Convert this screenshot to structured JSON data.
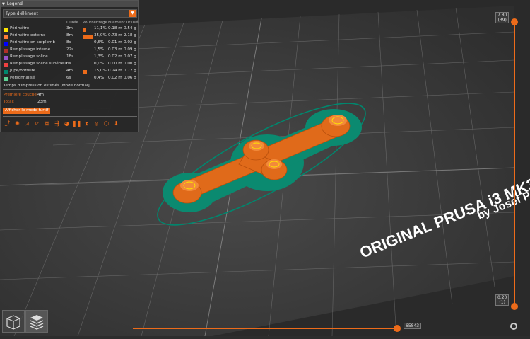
{
  "legend": {
    "title": "Legend",
    "view_type": "Type d'élément",
    "columns": {
      "duration": "Durée",
      "percentage": "Pourcentage",
      "filament": "Filament utilisé"
    },
    "rows": [
      {
        "name": "Périmètre",
        "color": "#ffe600",
        "duration": "3m",
        "pct": "11,1%",
        "len": "0.18 m",
        "weight": "0.54 g",
        "fraction": 0.111
      },
      {
        "name": "Périmètre externe",
        "color": "#ff7d38",
        "duration": "8m",
        "pct": "35,0%",
        "len": "0.73 m",
        "weight": "2.18 g",
        "fraction": 0.35
      },
      {
        "name": "Périmètre en surplomb",
        "color": "#0000ff",
        "duration": "8s",
        "pct": "0,6%",
        "len": "0.01 m",
        "weight": "0.02 g",
        "fraction": 0.006
      },
      {
        "name": "Remplissage interne",
        "color": "#b03029",
        "duration": "22s",
        "pct": "1,5%",
        "len": "0.03 m",
        "weight": "0.09 g",
        "fraction": 0.015
      },
      {
        "name": "Remplissage solide",
        "color": "#9654cc",
        "duration": "18s",
        "pct": "1,3%",
        "len": "0.02 m",
        "weight": "0.07 g",
        "fraction": 0.013
      },
      {
        "name": "Remplissage solide supérieur",
        "color": "#f04040",
        "duration": "0s",
        "pct": "0,0%",
        "len": "0.00 m",
        "weight": "0.00 g",
        "fraction": 0.0
      },
      {
        "name": "Jupe/Bordure",
        "color": "#00876e",
        "duration": "4m",
        "pct": "15,0%",
        "len": "0.24 m",
        "weight": "0.72 g",
        "fraction": 0.15
      },
      {
        "name": "Personnalisé",
        "color": "#5ed194",
        "duration": "6s",
        "pct": "0,4%",
        "len": "0.02 m",
        "weight": "0.06 g",
        "fraction": 0.004
      }
    ],
    "estimated_label": "Temps d'impression estimés [Mode normal]:",
    "first_layer_label": "Première couche:",
    "first_layer_value": "4m",
    "total_label": "Total:",
    "total_value": "23m",
    "stealth_button": "Afficher le mode furtif"
  },
  "slider_v": {
    "top_value": "7.80",
    "top_layer": "(39)",
    "bottom_value": "0.20",
    "bottom_layer": "(1)"
  },
  "slider_h": {
    "value": "65843"
  },
  "bed": {
    "brand_line1": "ORIGINAL PRUSA i3 MK3",
    "brand_line2": "by Josef Pr"
  },
  "colors": {
    "accent": "#ec6b1a",
    "bed": "#3a3a3a",
    "skirt": "#00876e",
    "part": "#e06a1a"
  }
}
